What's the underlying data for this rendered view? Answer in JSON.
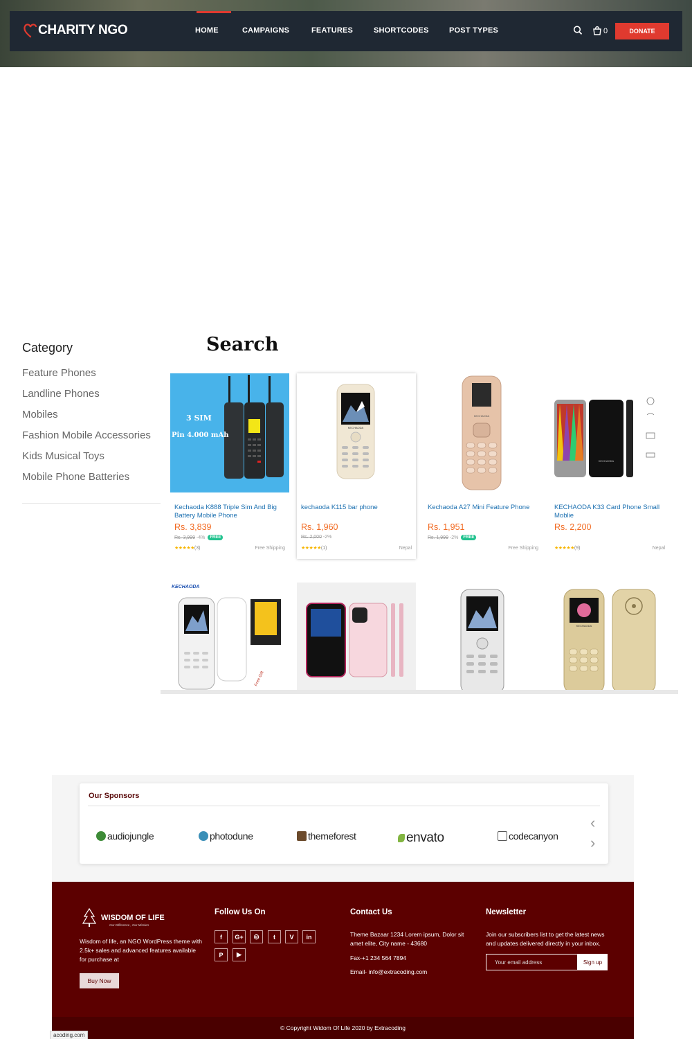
{
  "header": {
    "logo_text": "CHARITY NGO",
    "nav": [
      "HOME",
      "CAMPAIGNS",
      "FEATURES",
      "SHORTCODES",
      "POST TYPES"
    ],
    "active_nav": "HOME",
    "cart_count": "0",
    "donate_label": "DONATE"
  },
  "sidebar": {
    "title": "Category",
    "items": [
      "Feature Phones",
      "Landline Phones",
      "Mobiles",
      "Fashion Mobile Accessories",
      "Kids Musical Toys",
      "Mobile Phone Batteries"
    ]
  },
  "search_title": "Search",
  "products": [
    {
      "name": "Kechaoda K888 Triple Sim And Big Battery Mobile Phone",
      "price": "Rs. 3,839",
      "original": "Rs. 3,999",
      "discount": "-4%",
      "free": "FREE",
      "rating_count": "(3)",
      "right": "Free Shipping",
      "img_text_1": "3 SIM",
      "img_text_2": "Pin 4.000 mAh"
    },
    {
      "name": "kechaoda K115 bar phone",
      "price": "Rs. 1,960",
      "original": "Rs. 2,000",
      "discount": "-2%",
      "free": "",
      "rating_count": "(1)",
      "right": "Nepal",
      "brand": "KECHAODA"
    },
    {
      "name": "Kechaoda A27 Mini Feature Phone",
      "price": "Rs. 1,951",
      "original": "Rs. 1,999",
      "discount": "-2%",
      "free": "FREE",
      "rating_count": "",
      "right": "Free Shipping",
      "brand": "KECHAODA"
    },
    {
      "name": "KECHAODA K33 Card Phone Small Moblie",
      "price": "Rs. 2,200",
      "original": "",
      "discount": "",
      "free": "",
      "rating_count": "(9)",
      "right": "Nepal",
      "brand": "KECHAODA"
    }
  ],
  "products_row2": [
    {
      "brand_label": "KECHAODA"
    },
    {
      "brand_label": ""
    },
    {
      "brand_label": ""
    },
    {
      "brand_label": "KECHAODA"
    }
  ],
  "sponsors": {
    "title": "Our Sponsors",
    "brands": [
      "audiojungle",
      "photodune",
      "themeforest",
      "envato",
      "codecanyon"
    ]
  },
  "footer": {
    "logo_text": "WISDOM OF LIFE",
    "logo_sub": "Our Difference , Our Mission",
    "about": "Wisdom of life, an NGO WordPress theme with 2.5k+ sales and advanced features available for purchase at",
    "buy_now": "Buy Now",
    "follow_title": "Follow Us On",
    "social": [
      "f",
      "G+",
      "◎",
      "t",
      "V",
      "in",
      "P",
      "▶"
    ],
    "contact_title": "Contact Us",
    "address": "Theme Bazaar 1234 Lorem ipsum, Dolor sit amet elite, City name - 43680",
    "fax": "Fax-+1 234 564 7894",
    "email": "Email- info@extracoding.com",
    "newsletter_title": "Newsletter",
    "newsletter_text": "Join our subscribers list to get the latest news and updates delivered directly in your inbox.",
    "email_placeholder": "Your email address",
    "signup": "Sign up",
    "copyright": "© Copyright Widom Of Life 2020 by Extracoding"
  },
  "status_url": "acoding.com",
  "colors": {
    "accent": "#e03a2f",
    "nav_bg": "#1f2833",
    "footer_bg": "#5c0000",
    "price": "#f26a21",
    "link": "#1a6fb0"
  }
}
